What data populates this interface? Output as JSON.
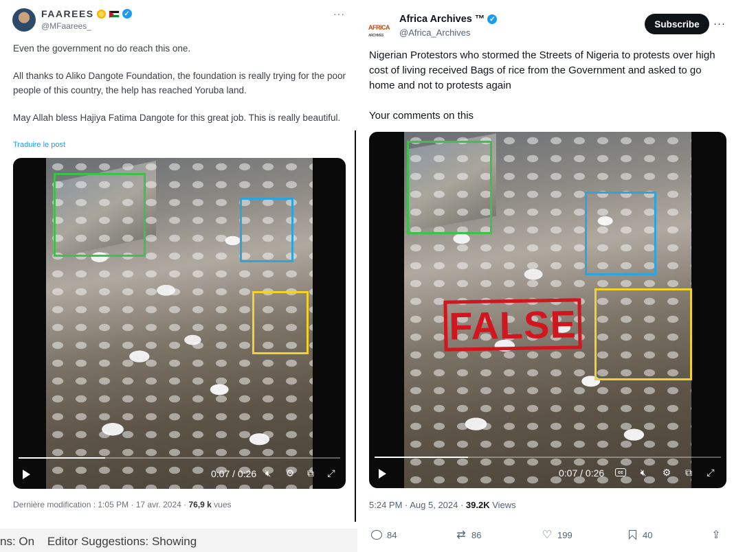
{
  "left_post": {
    "display_name": "FAAREES",
    "handle": "@MFaarees_",
    "paragraphs": [
      "Even the government no do reach this one.",
      "All thanks to Aliko Dangote Foundation, the foundation is really trying for the poor people of this country, the help has reached Yoruba land.",
      "May Allah bless Hajiya Fatima Dangote for this great job. This is really beautiful."
    ],
    "translate_link": "Traduire le post",
    "video": {
      "time": "0:07 / 0:26",
      "progress": 0.27
    },
    "meta_prefix": "Dernière modification : 1:05 PM · 17 avr. 2024 · ",
    "views_count": "76,9 k",
    "views_label": " vues"
  },
  "right_post": {
    "display_name": "Africa Archives ™",
    "handle": "@Africa_Archives",
    "logo_text": "AFRICA",
    "logo_sub": "ARCHIVES",
    "subscribe_label": "Subscribe",
    "text": "Nigerian Protestors who stormed the Streets of Nigeria to protests over high cost of living received Bags of rice from the Government and asked to go home and not to protests again",
    "text2": "Your comments on this",
    "stamp": "FALSE",
    "video": {
      "time": "0:07 / 0:26",
      "progress": 0.27,
      "cc_label": "cc"
    },
    "meta_prefix": "5:24 PM · Aug 5, 2024 · ",
    "views_count": "39.2K",
    "views_label": " Views",
    "actions": {
      "replies": "84",
      "reposts": "86",
      "likes": "199",
      "bookmarks": "40"
    }
  },
  "status_bar": {
    "items": [
      "ns: On",
      "Editor Suggestions: Showing"
    ]
  },
  "colors": {
    "verified": "#1d9bf0",
    "box_green": "#3cc24a",
    "box_blue": "#2aa5e0",
    "box_yellow": "#f2d22b",
    "stamp_red": "#d0161f"
  },
  "icons": [
    "verified-icon",
    "more-icon",
    "play-icon",
    "volume-mute-icon",
    "settings-icon",
    "pip-icon",
    "fullscreen-icon",
    "cc-icon",
    "reply-icon",
    "repost-icon",
    "like-icon",
    "bookmark-icon",
    "share-icon"
  ]
}
